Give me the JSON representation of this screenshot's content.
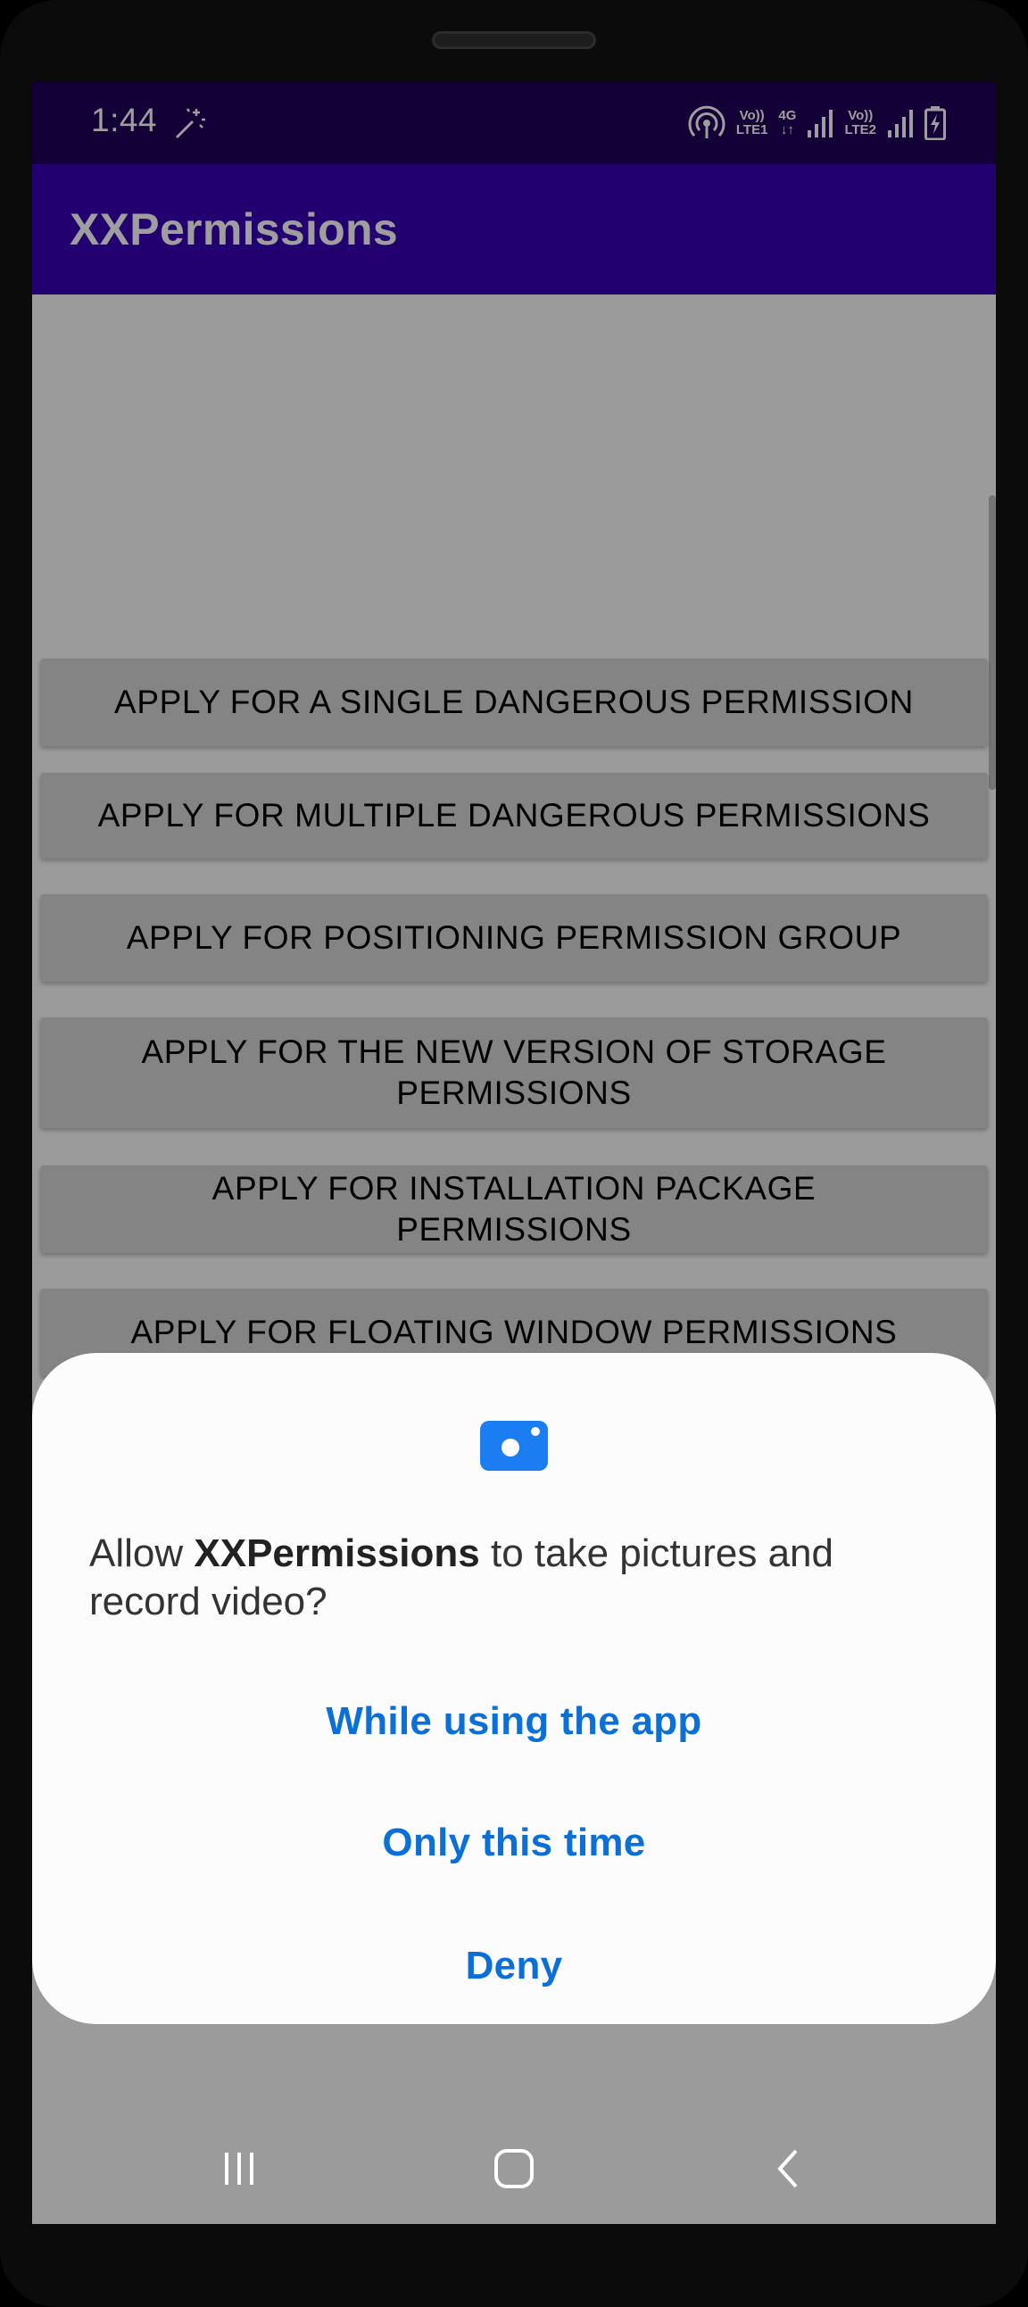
{
  "status_bar": {
    "time": "1:44",
    "network": {
      "sim1_top": "Vo))",
      "sim1_bottom": "LTE1",
      "sim1_type": "4G",
      "sim2_top": "Vo))",
      "sim2_bottom": "LTE2"
    },
    "icons": [
      "magic-wand-icon",
      "hotspot-icon",
      "signal-icon",
      "signal-icon",
      "battery-charging-icon"
    ]
  },
  "app_bar": {
    "title": "XXPermissions"
  },
  "buttons": [
    {
      "label": "APPLY FOR A SINGLE DANGEROUS PERMISSION"
    },
    {
      "label": "APPLY FOR MULTIPLE DANGEROUS PERMISSIONS"
    },
    {
      "label": "APPLY FOR POSITIONING PERMISSION GROUP"
    },
    {
      "label": "APPLY FOR THE NEW VERSION OF STORAGE PERMISSIONS"
    },
    {
      "label": "APPLY FOR INSTALLATION PACKAGE PERMISSIONS"
    },
    {
      "label": "APPLY FOR FLOATING WINDOW PERMISSIONS"
    }
  ],
  "dialog": {
    "icon": "camera-icon",
    "message_prefix": "Allow ",
    "app_name": "XXPermissions",
    "message_suffix": " to take pictures and record video?",
    "options": [
      {
        "label": "While using the app"
      },
      {
        "label": "Only this time"
      },
      {
        "label": "Deny"
      }
    ]
  },
  "nav_bar": {
    "items": [
      "recent-apps-icon",
      "home-icon",
      "back-icon"
    ]
  },
  "colors": {
    "status_bar": "#1d005a",
    "app_bar": "#3700b3",
    "dialog_accent": "#0a6fd6",
    "camera_icon": "#1a7ef2"
  }
}
